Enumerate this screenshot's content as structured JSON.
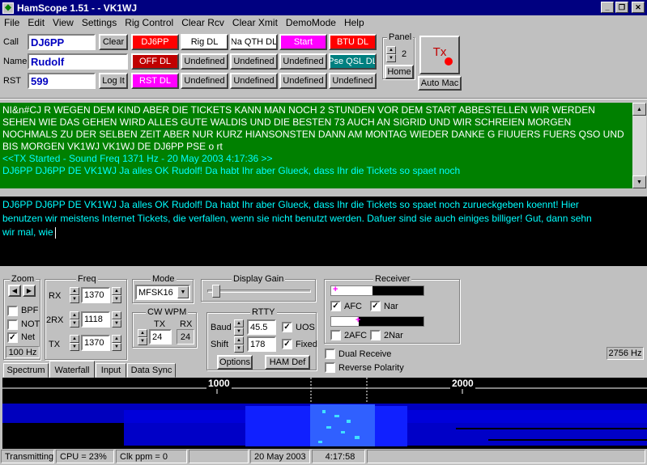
{
  "window": {
    "title": "HamScope 1.51 - - VK1WJ"
  },
  "menu": [
    "File",
    "Edit",
    "View",
    "Settings",
    "Rig Control",
    "Clear Rcv",
    "Clear Xmit",
    "DemoMode",
    "Help"
  ],
  "station": {
    "call_label": "Call",
    "call_value": "DJ6PP",
    "clear_label": "Clear",
    "name_label": "Name",
    "name_value": "Rudolf",
    "rst_label": "RST",
    "rst_value": "599",
    "logit_label": "Log It"
  },
  "macros": {
    "row1": [
      "DJ6PP",
      "Rig DL",
      "Na QTH DL",
      "Start",
      "BTU DL"
    ],
    "row2": [
      "OFF DL",
      "Undefined",
      "Undefined",
      "Undefined",
      "Pse QSL DL"
    ],
    "row3": [
      "RST DL",
      "Undefined",
      "Undefined",
      "Undefined",
      "Undefined"
    ]
  },
  "colors": {
    "red": "#ff0000",
    "magenta": "#ff00ff",
    "teal": "#008080",
    "rx_bg": "#008000",
    "tx_bg": "#000000",
    "waterfall": "#0000ff"
  },
  "panel": {
    "label": "Panel",
    "value": "2",
    "home_label": "Home",
    "tx_label": "Tx",
    "automac_label": "Auto Mac"
  },
  "receive_text": {
    "lines": [
      "NI&n#CJ R   WEGEN DEM KIND   ABER DIE TICKETS KANN MAN NOCH 2 STUNDEN VOR DEM START ABBESTELLEN    WIR WERDEN",
      "SEHEN WIE DAS GEHEN WIRD    ALLES GUTE  WALDIS UND DIE BESTEN 73 AUCH AN SIGRID  UND WIR   SCHREIEN MORGEN",
      "NOCHMALS ZU DER SELBEN ZEIT  ABER NUR KURZ HIANSONSTEN DANN AM MONTAG WIEDER  DANKE G  FIUUERS  FUERS QSO  UND",
      "BIS MORGEN  VK1WJ VK1WJ DE DJ6PP PSE o rt"
    ],
    "tx_started": "<<TX Started - Sound Freq 1371 Hz - 20 May 2003 4:17:36  >>",
    "echo": "DJ6PP DJ6PP DE VK1WJ Ja alles OK Rudolf! Da habt Ihr aber Glueck, dass Ihr die Tickets so spaet noch"
  },
  "transmit_text": {
    "lines": [
      "DJ6PP DJ6PP DE VK1WJ Ja alles OK Rudolf! Da habt Ihr aber Glueck, dass Ihr die Tickets so spaet noch zurueckgeben koennt! Hier",
      "benutzen wir meistens Internet Tickets, die verfallen, wenn sie nicht benutzt werden. Dafuer sind sie auch einiges billiger! Gut, dann sehn",
      "wir mal, wie"
    ]
  },
  "zoom": {
    "label": "Zoom",
    "bpf": "BPF",
    "not": "NOT",
    "net": "Net",
    "bw": "100 Hz"
  },
  "freq": {
    "label": "Freq",
    "rx_label": "RX",
    "rx": "1370",
    "rx2_label": "2RX",
    "rx2": "1118",
    "tx_label": "TX",
    "tx": "1370"
  },
  "mode": {
    "label": "Mode",
    "value": "MFSK16"
  },
  "cw_wpm": {
    "label": "CW WPM",
    "tx_label": "TX",
    "tx": "24",
    "rx_label": "RX",
    "rx": "24"
  },
  "display_gain": {
    "label": "Display Gain",
    "level": 0.05
  },
  "rtty": {
    "label": "RTTY",
    "baud_label": "Baud",
    "baud": "45.5",
    "uos": "UOS",
    "shift_label": "Shift",
    "shift": "178",
    "fixed": "Fixed",
    "options_label": "Options",
    "hamdef_label": "HAM Def"
  },
  "receiver": {
    "label": "Receiver",
    "afc": "AFC",
    "nar": "Nar",
    "afc2": "2AFC",
    "nar2": "2Nar",
    "dual": "Dual Receive",
    "reverse": "Reverse Polarity",
    "freq_readout": "2756 Hz",
    "level1": 0.45,
    "level2": 0.3
  },
  "tabs": [
    "Spectrum",
    "Waterfall",
    "Input",
    "Data Sync"
  ],
  "scale": {
    "marks": [
      "1000",
      "2000"
    ]
  },
  "status": {
    "state": "Transmitting",
    "cpu": "CPU = 23%",
    "clk": "Clk ppm = 0",
    "date": "20 May 2003",
    "time": "4:17:58"
  }
}
